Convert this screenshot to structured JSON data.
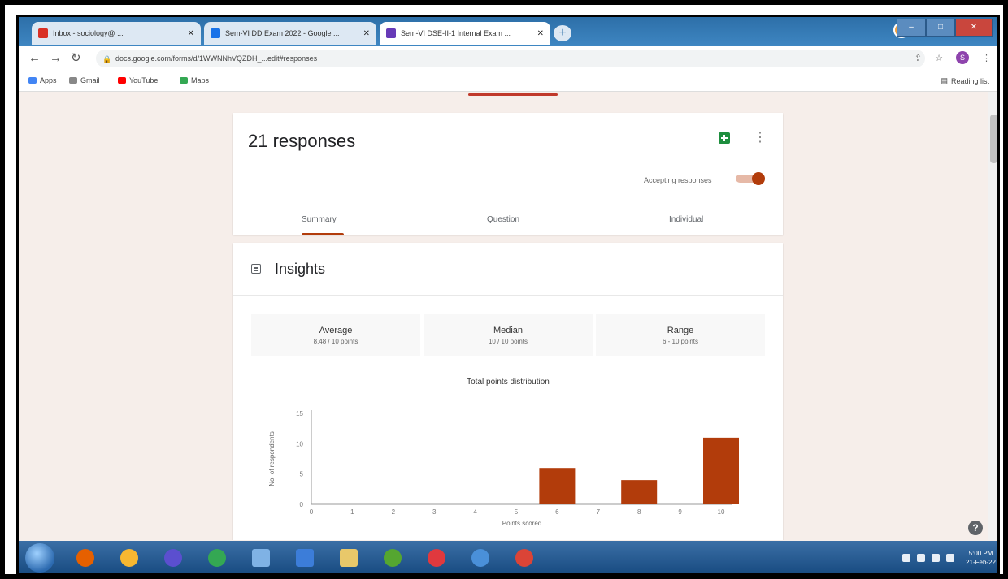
{
  "browser": {
    "tabs": [
      {
        "label": "Inbox - sociology@ ...",
        "icon_color": "#d93025",
        "active": false
      },
      {
        "label": "Sem-VI DD Exam 2022 - Google ...",
        "icon_color": "#1a73e8",
        "active": false
      },
      {
        "label": "Sem-VI DSE-II-1 Internal Exam ...",
        "icon_color": "#673ab7",
        "active": true
      }
    ],
    "new_tab": "+",
    "url": "docs.google.com/forms/d/1WWNNhVQZDH_...edit#responses",
    "bookmarks": [
      {
        "label": "Apps",
        "color": "#4285f4"
      },
      {
        "label": "Gmail",
        "color": "#888888"
      },
      {
        "label": "YouTube",
        "color": "#ff0000"
      },
      {
        "label": "Maps",
        "color": "#34a853"
      }
    ],
    "reading_list": "Reading list",
    "profile_initial": "S"
  },
  "form": {
    "responses_title": "21 responses",
    "accepting_label": "Accepting responses",
    "accepting_on": true,
    "tabs": [
      {
        "label": "Summary",
        "active": true
      },
      {
        "label": "Question",
        "active": false
      },
      {
        "label": "Individual",
        "active": false
      }
    ]
  },
  "insights": {
    "title": "Insights",
    "stats": [
      {
        "label": "Average",
        "value": "8.48 / 10 points"
      },
      {
        "label": "Median",
        "value": "10 / 10 points"
      },
      {
        "label": "Range",
        "value": "6 - 10 points"
      }
    ]
  },
  "chart_data": {
    "type": "bar",
    "title": "Total points distribution",
    "xlabel": "Points scored",
    "ylabel": "No. of respondents",
    "categories": [
      "0",
      "1",
      "2",
      "3",
      "4",
      "5",
      "6",
      "7",
      "8",
      "9",
      "10"
    ],
    "values": [
      0,
      0,
      0,
      0,
      0,
      0,
      6,
      0,
      4,
      0,
      11
    ],
    "ylim": [
      0,
      15
    ],
    "yticks": [
      0,
      5,
      10,
      15
    ],
    "bar_color": "#b23c0b",
    "grid": false
  },
  "taskbar": {
    "items": [
      {
        "name": "firefox",
        "color": "#e66000"
      },
      {
        "name": "orb",
        "color": "#f7b731"
      },
      {
        "name": "media-player",
        "color": "#5b4fcf"
      },
      {
        "name": "chrome",
        "color": "#34a853"
      },
      {
        "name": "screen",
        "color": "#7fb2e5"
      },
      {
        "name": "mail",
        "color": "#3c7dd9"
      },
      {
        "name": "folder",
        "color": "#e8c86a"
      },
      {
        "name": "app",
        "color": "#55a630"
      },
      {
        "name": "opera",
        "color": "#e0393e"
      },
      {
        "name": "tool",
        "color": "#4a90d9"
      },
      {
        "name": "chrome-2",
        "color": "#db4437"
      }
    ],
    "time": "5:00 PM",
    "date": "21-Feb-22"
  }
}
